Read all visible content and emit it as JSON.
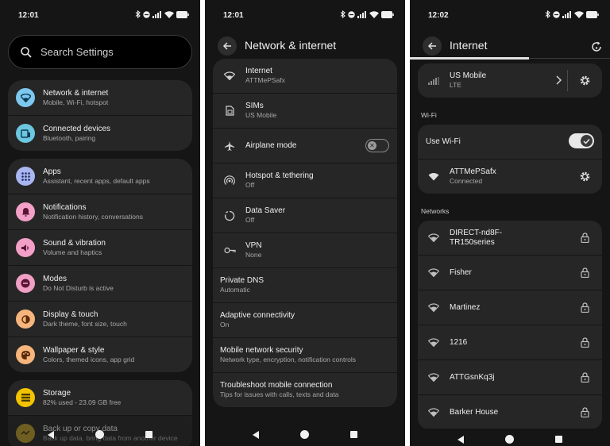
{
  "colors": {
    "background": "#151515",
    "card": "#262626",
    "network_icon": "#7cc8ef",
    "devices_icon": "#6cc7e0",
    "apps_icon": "#a9b6f2",
    "notifications_icon": "#f2a0c8",
    "sound_icon": "#f2a0c8",
    "modes_icon": "#f0a0c4",
    "display_icon": "#f6b57d",
    "wallpaper_icon": "#f6b57d",
    "storage_icon": "#f2c300",
    "backup_icon": "#b89a2c"
  },
  "status_bar": [
    {
      "time": "12:01"
    },
    {
      "time": "12:01"
    },
    {
      "time": "12:02"
    }
  ],
  "settings_main": {
    "search_placeholder": "Search Settings",
    "groups": [
      [
        {
          "title": "Network & internet",
          "subtitle": "Mobile, Wi-Fi, hotspot",
          "icon": "wifi-icon"
        },
        {
          "title": "Connected devices",
          "subtitle": "Bluetooth, pairing",
          "icon": "devices-icon"
        }
      ],
      [
        {
          "title": "Apps",
          "subtitle": "Assistant, recent apps, default apps",
          "icon": "apps-grid-icon"
        },
        {
          "title": "Notifications",
          "subtitle": "Notification history, conversations",
          "icon": "bell-icon"
        },
        {
          "title": "Sound & vibration",
          "subtitle": "Volume and haptics",
          "icon": "speaker-icon"
        },
        {
          "title": "Modes",
          "subtitle": "Do Not Disturb is active",
          "icon": "dnd-icon"
        },
        {
          "title": "Display & touch",
          "subtitle": "Dark theme, font size, touch",
          "icon": "brightness-icon"
        },
        {
          "title": "Wallpaper & style",
          "subtitle": "Colors, themed icons, app grid",
          "icon": "palette-icon"
        }
      ],
      [
        {
          "title": "Storage",
          "subtitle": "82% used - 23.09 GB free",
          "icon": "storage-icon"
        },
        {
          "title": "Back up or copy data",
          "subtitle": "Back up data, bring data from another device",
          "icon": "backup-icon"
        }
      ]
    ]
  },
  "network_internet": {
    "title": "Network & internet",
    "items": [
      {
        "title": "Internet",
        "subtitle": "ATTMePSafx",
        "icon": "wifi-icon"
      },
      {
        "title": "SIMs",
        "subtitle": "US Mobile",
        "icon": "sim-icon"
      },
      {
        "title": "Airplane mode",
        "subtitle": "",
        "icon": "airplane-icon"
      },
      {
        "title": "Hotspot & tethering",
        "subtitle": "Off",
        "icon": "hotspot-icon"
      },
      {
        "title": "Data Saver",
        "subtitle": "Off",
        "icon": "data-saver-icon"
      },
      {
        "title": "VPN",
        "subtitle": "None",
        "icon": "vpn-key-icon"
      },
      {
        "title": "Private DNS",
        "subtitle": "Automatic"
      },
      {
        "title": "Adaptive connectivity",
        "subtitle": "On"
      },
      {
        "title": "Mobile network security",
        "subtitle": "Network type, encryption, notification controls"
      },
      {
        "title": "Troubleshoot mobile connection",
        "subtitle": "Tips for issues with calls, texts and data"
      }
    ]
  },
  "internet": {
    "title": "Internet",
    "carrier": {
      "title": "US Mobile",
      "subtitle": "LTE"
    },
    "wifi_section": "Wi-Fi",
    "use_wifi_label": "Use Wi-Fi",
    "connected": {
      "title": "ATTMePSafx",
      "subtitle": "Connected"
    },
    "networks_section": "Networks",
    "networks": [
      {
        "name": "DIRECT-nd8F-TR150series"
      },
      {
        "name": "Fisher"
      },
      {
        "name": "Martinez"
      },
      {
        "name": "1216"
      },
      {
        "name": "ATTGsnKq3j"
      },
      {
        "name": "Barker House"
      }
    ]
  }
}
